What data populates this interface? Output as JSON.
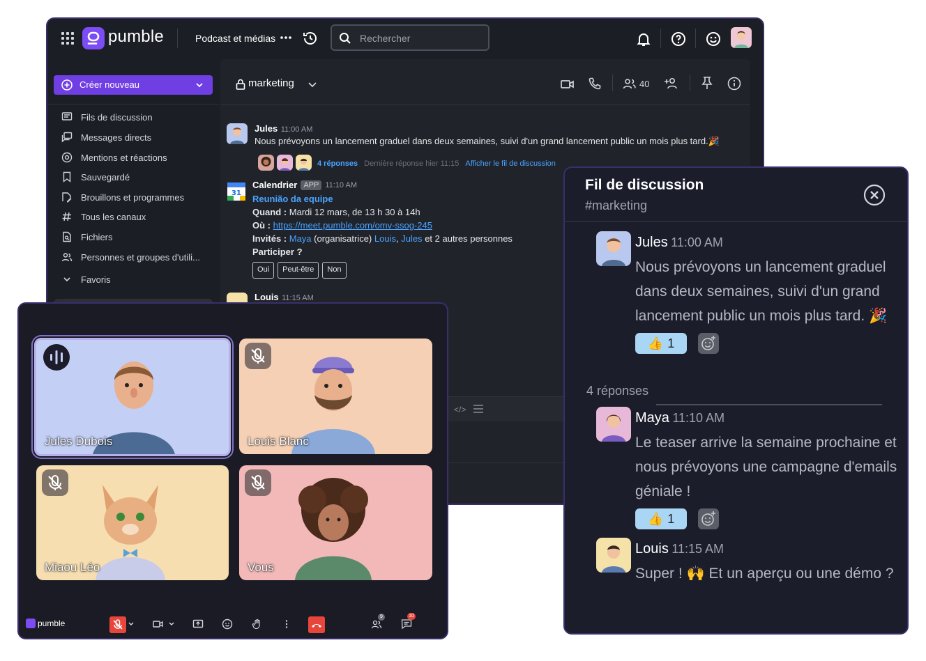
{
  "app": {
    "logo_text": "pumble",
    "workspace": "Podcast et médias",
    "search_placeholder": "Rechercher",
    "accent": "#7c4cf5"
  },
  "sidebar": {
    "create_label": "Créer nouveau",
    "items": [
      {
        "label": "Fils de discussion",
        "icon": "threads-icon"
      },
      {
        "label": "Messages directs",
        "icon": "direct-messages-icon"
      },
      {
        "label": "Mentions et réactions",
        "icon": "at-icon"
      },
      {
        "label": "Sauvegardé",
        "icon": "bookmark-icon"
      },
      {
        "label": "Brouillons et programmes",
        "icon": "drafts-icon"
      },
      {
        "label": "Tous les canaux",
        "icon": "channels-icon"
      },
      {
        "label": "Fichiers",
        "icon": "files-icon"
      },
      {
        "label": "Personnes et groupes d'utili...",
        "icon": "people-icon"
      }
    ],
    "favorites_label": "Favoris"
  },
  "channel": {
    "name": "marketing",
    "member_count": "40",
    "messages": [
      {
        "author": "Jules",
        "time": "11:00 AM",
        "text": "Nous prévoyons un lancement graduel dans deux semaines, suivi d'un grand lancement public un mois plus tard.🎉",
        "replies": "4 réponses",
        "last_reply": "Dernière réponse hier 11:15",
        "view_thread": "Afficher le fil de discussion"
      },
      {
        "author": "Calendrier",
        "badge": "APP",
        "time": "11:10 AM",
        "event_title": "Reunião da equipe",
        "when_label": "Quand :",
        "when_value": "Mardi 12 mars, de 13 h 30 à 14h",
        "where_label": "Où :",
        "where_link": "https://meet.pumble.com/omv-ssog-245",
        "guests_label": "Invités :",
        "guest1": "Maya",
        "guest1_role": "(organisatrice)",
        "guest2": "Louis",
        "guest3": "Jules",
        "guests_more": "et 2 autres personnes",
        "rsvp_label": "Participer ?",
        "rsvp_options": [
          "Oui",
          "Peut-être",
          "Non"
        ],
        "calendar_day": "31"
      },
      {
        "author": "Louis",
        "time": "11:15 AM"
      }
    ]
  },
  "call": {
    "participants": [
      {
        "name": "Jules Dubois",
        "state": "speaking",
        "bg": "#c4cff5"
      },
      {
        "name": "Louis Blanc",
        "state": "muted",
        "bg": "#f6d0b4"
      },
      {
        "name": "Miaou Léo",
        "state": "muted",
        "bg": "#f6deb0"
      },
      {
        "name": "Vous",
        "state": "muted",
        "bg": "#f3b8b8"
      }
    ],
    "logo_text": "pumble",
    "participants_badge": "9",
    "chat_badge": "10"
  },
  "thread": {
    "title": "Fil de discussion",
    "channel": "#marketing",
    "replies_label": "4 réponses",
    "messages": [
      {
        "author": "Jules",
        "time": "11:00 AM",
        "lines": [
          "Nous prévoyons un lancement graduel",
          "dans deux semaines, suivi d'un grand",
          "lancement public un mois plus tard. 🎉"
        ],
        "reaction": "👍",
        "reaction_count": "1"
      },
      {
        "author": "Maya",
        "time": "11:10 AM",
        "lines": [
          "Le teaser arrive la semaine prochaine et",
          "nous prévoyons une campagne d'emails",
          "géniale !"
        ],
        "reaction": "👍",
        "reaction_count": "1"
      },
      {
        "author": "Louis",
        "time": "11:15 AM",
        "lines": [
          "Super ! 🙌 Et un aperçu ou une démo ?"
        ]
      }
    ]
  }
}
